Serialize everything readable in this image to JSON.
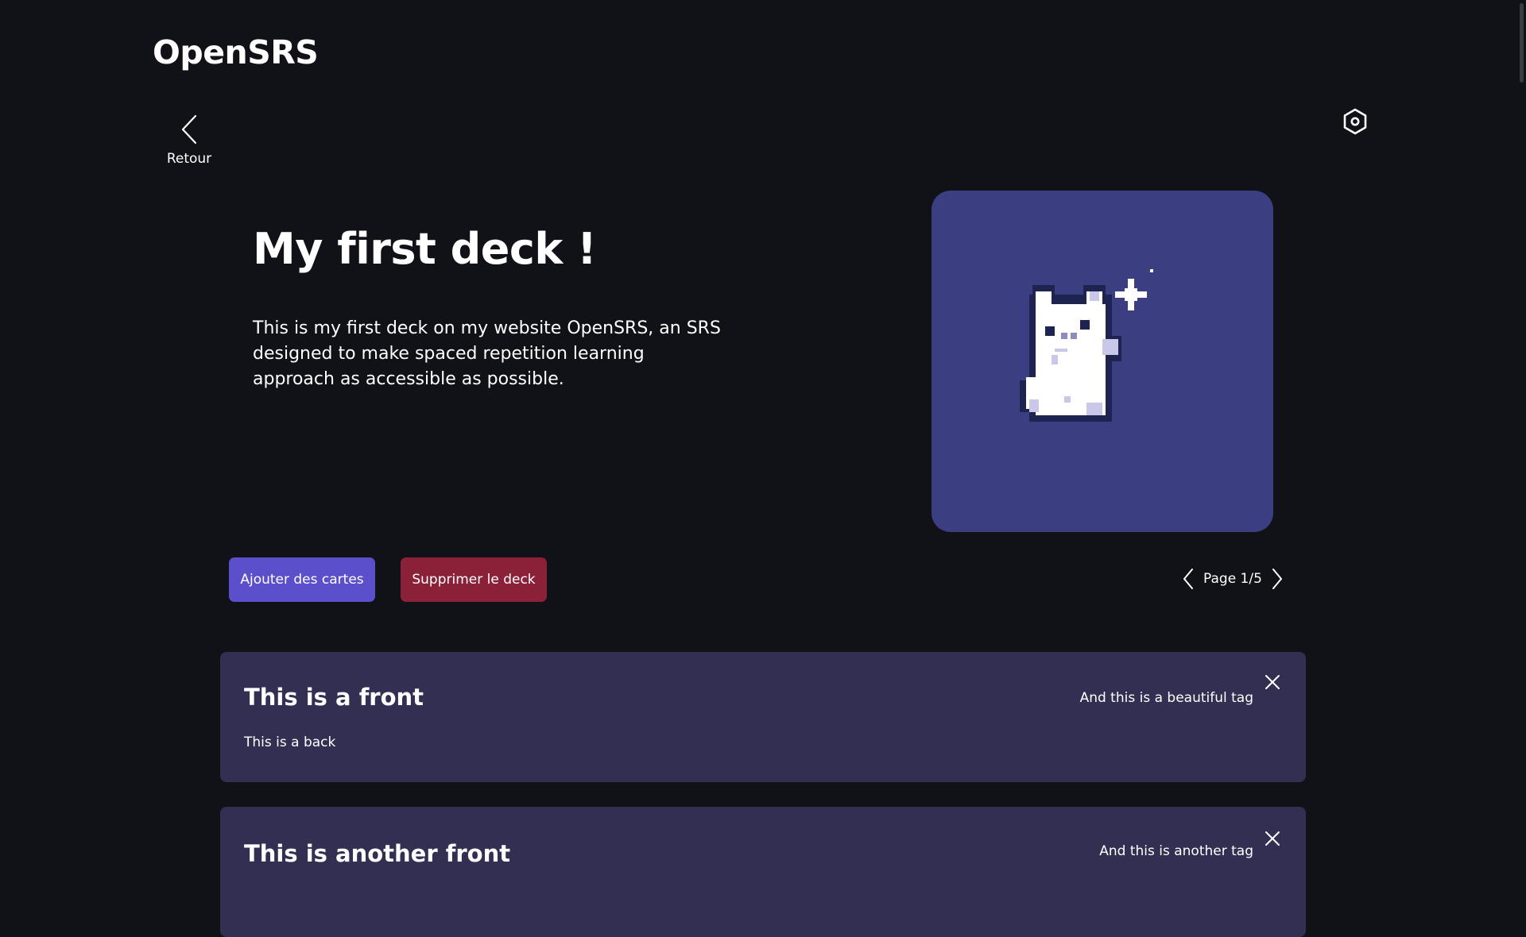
{
  "app": {
    "brand": "OpenSRS"
  },
  "nav": {
    "back_label": "Retour"
  },
  "deck": {
    "title": "My first deck !",
    "description": "This is my first deck on my website OpenSRS, an SRS designed to make spaced repetition learning approach as accessible as possible."
  },
  "actions": {
    "add_cards": "Ajouter des cartes",
    "delete_deck": "Supprimer le deck"
  },
  "pagination": {
    "label": "Page 1/5",
    "current": 1,
    "total": 5
  },
  "cards": [
    {
      "front": "This is a front",
      "back": "This is a back",
      "tag": "And this is a beautiful tag"
    },
    {
      "front": "This is another front",
      "tag": "And this is another tag"
    }
  ],
  "icons": {
    "back": "chevron-left-icon",
    "settings": "hexagon-gear-icon",
    "prev": "chevron-left-icon",
    "next": "chevron-right-icon",
    "close": "close-icon"
  },
  "colors": {
    "background": "#111118",
    "card": "#332f52",
    "image_bg": "#3b3f82",
    "primary_button": "#5b4fcb",
    "danger_button": "#8a2138"
  }
}
